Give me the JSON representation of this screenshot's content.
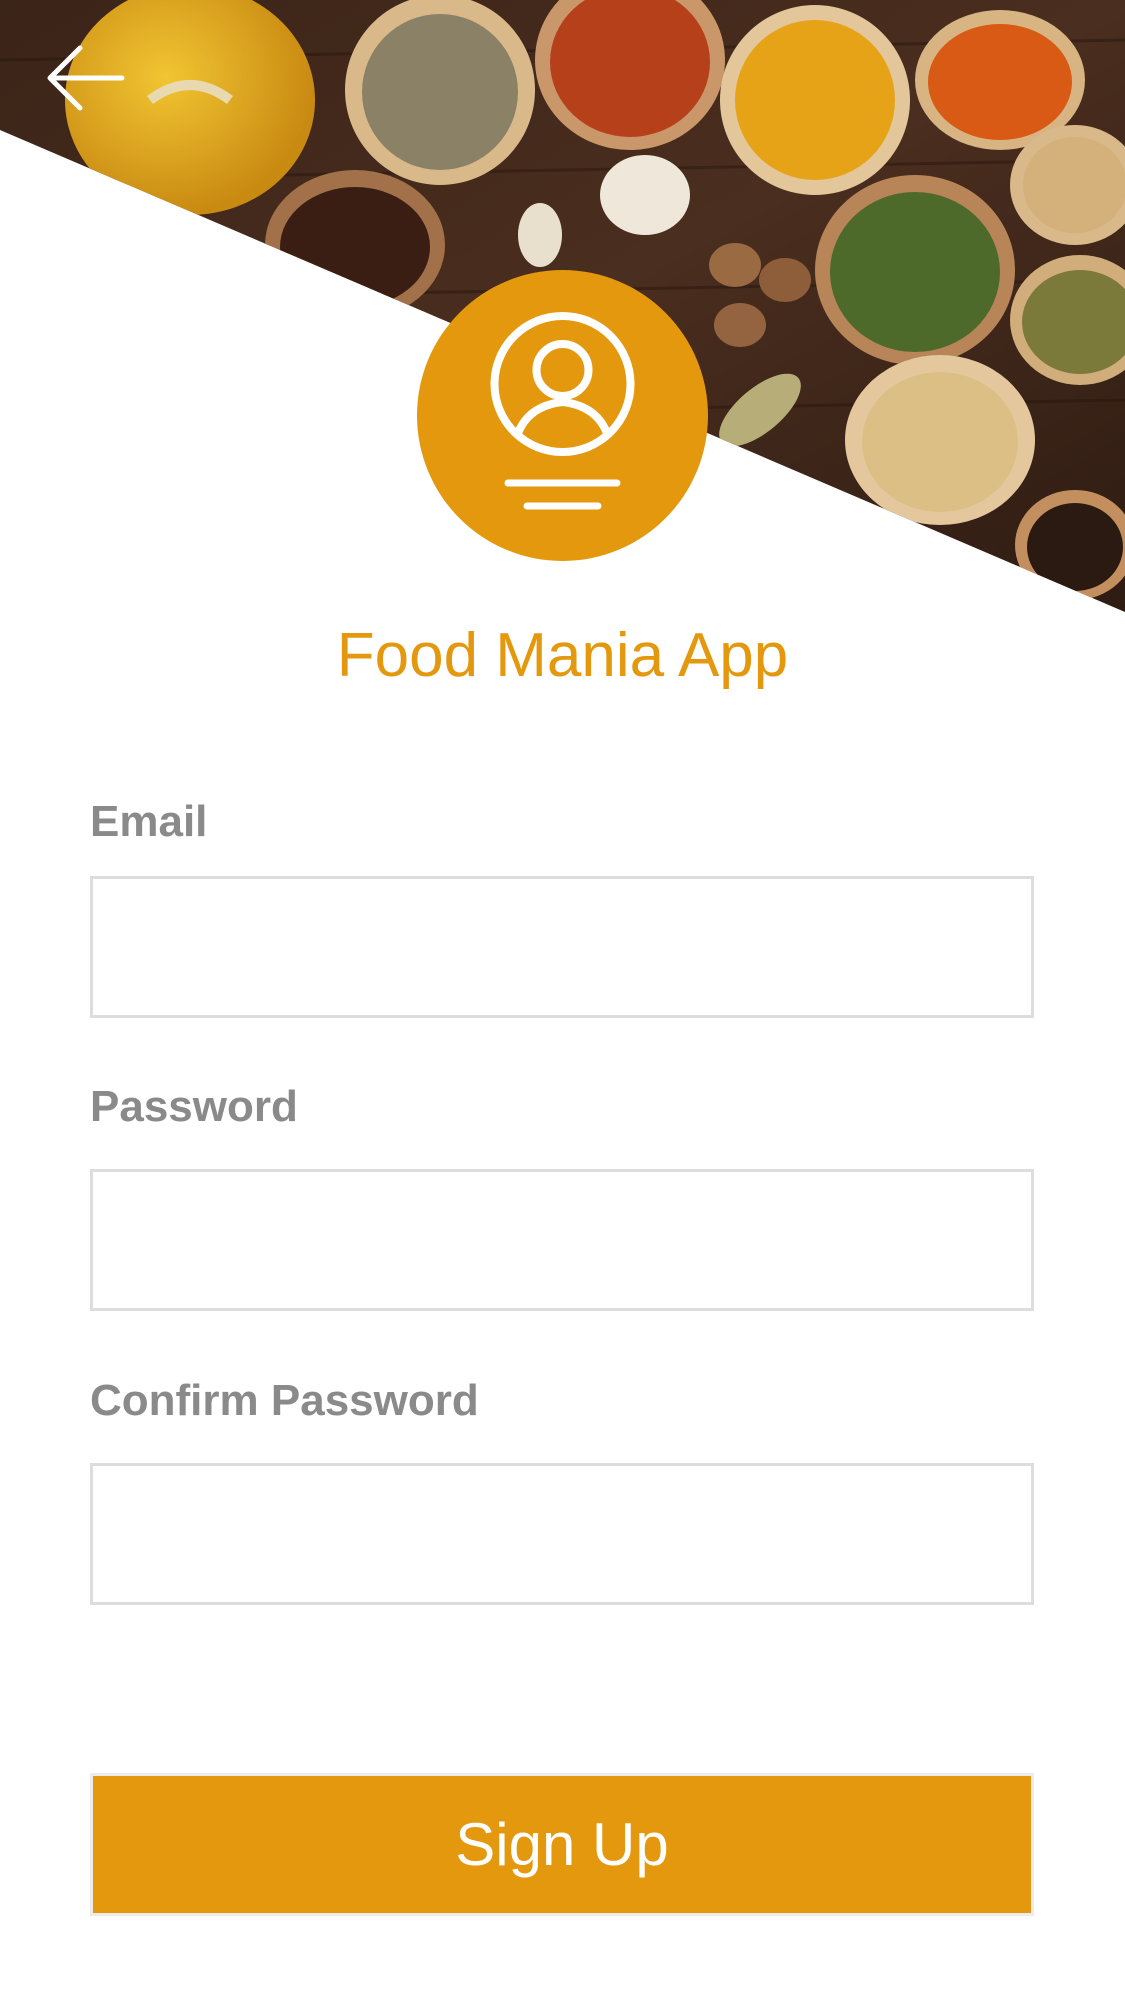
{
  "header": {
    "back_icon": "arrow-left-icon",
    "avatar_icon": "user-profile-icon"
  },
  "app": {
    "title": "Food Mania App"
  },
  "form": {
    "email_label": "Email",
    "email_value": "",
    "password_label": "Password",
    "password_value": "",
    "confirm_password_label": "Confirm Password",
    "confirm_password_value": "",
    "submit_label": "Sign Up"
  },
  "colors": {
    "accent": "#E4980D",
    "label": "#8a8a8a",
    "input_border": "#dddddd"
  }
}
